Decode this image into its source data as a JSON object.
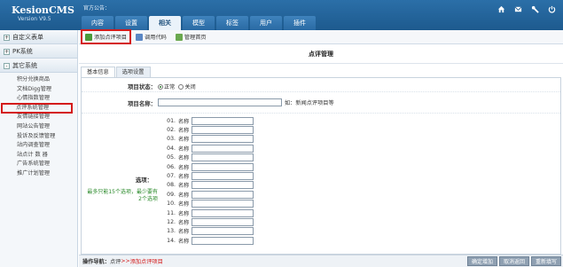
{
  "header": {
    "logo": "KesionCMS",
    "version": "Version V9.5",
    "notice": "官方公告：",
    "tabs": [
      "内容",
      "设置",
      "相关",
      "模型",
      "标签",
      "用户",
      "插件"
    ],
    "active_tab": "相关",
    "icons": [
      "home-icon",
      "mail-icon",
      "tools-icon",
      "power-icon"
    ]
  },
  "sidebar": {
    "sections": [
      {
        "label": "自定义表单",
        "toggle": "+"
      },
      {
        "label": "PK系统",
        "toggle": "+"
      },
      {
        "label": "其它系统",
        "toggle": "-"
      }
    ],
    "items": [
      "积分兑换商品",
      "文档Digg管理",
      "心情指数管理",
      "点评系统管理",
      "友情链接管理",
      "网站公告管理",
      "投诉及反馈管理",
      "站内调查管理",
      "站点计 数 器",
      "广告系统管理",
      "推广计划管理"
    ],
    "highlighted_item": "点评系统管理"
  },
  "toolbar": {
    "buttons": [
      {
        "label": "添加点评项目",
        "icon": "add-icon"
      },
      {
        "label": "调用代码",
        "icon": "code-icon"
      },
      {
        "label": "管理首页",
        "icon": "home-icon"
      }
    ]
  },
  "main": {
    "title": "点评管理",
    "form_tabs": [
      "基本信息",
      "选项设置"
    ],
    "status_label": "项目状态：",
    "status_options": [
      "正常",
      "关闭"
    ],
    "status_selected": "正常",
    "name_label": "项目名称：",
    "name_value": "",
    "name_hint": "如：新闻点评项目等",
    "options_label": "选项：",
    "options_hint": "最多只能15个选项，最少要有2个选项",
    "option_numbers": [
      "01.",
      "02.",
      "03.",
      "04.",
      "05.",
      "06.",
      "07.",
      "08.",
      "09.",
      "10.",
      "11.",
      "12.",
      "13.",
      "14."
    ],
    "option_name_label": "名称"
  },
  "footer": {
    "nav_label": "操作导航：",
    "crumb_root": "点评",
    "crumb_sep": " >> ",
    "crumb_current": "添加点评项目",
    "buttons": [
      "确定增加",
      "取消返回",
      "重新填写"
    ]
  },
  "colors": {
    "header_bg": "#1d5a8e",
    "highlight": "#d41a1a",
    "hint_green": "#2a8a2a"
  }
}
